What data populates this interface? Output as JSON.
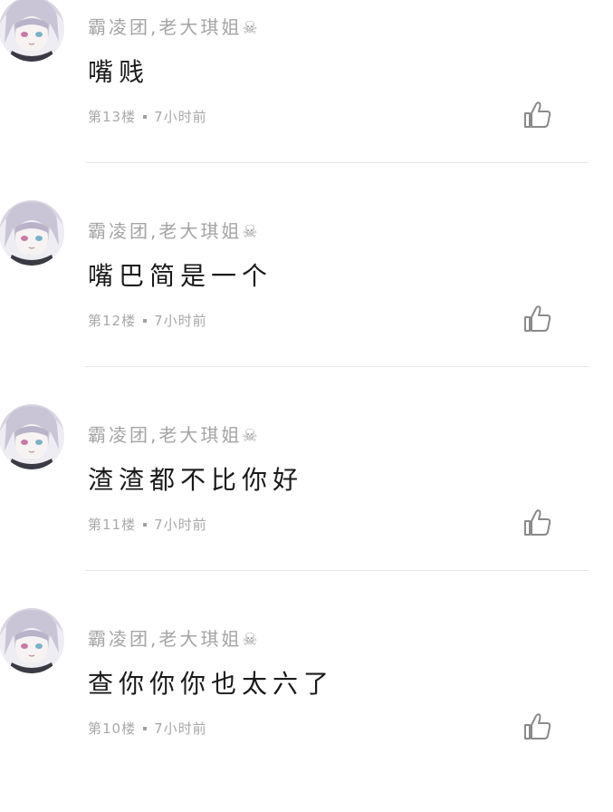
{
  "comments": [
    {
      "username": "霸凌团,老大琪姐",
      "username_icon": "skull-crossbones-icon",
      "text": "嘴贱",
      "floor": "第13楼",
      "time": "7小时前",
      "like_icon": "thumbs-up-icon"
    },
    {
      "username": "霸凌团,老大琪姐",
      "username_icon": "skull-crossbones-icon",
      "text": "嘴巴简是一个",
      "floor": "第12楼",
      "time": "7小时前",
      "like_icon": "thumbs-up-icon"
    },
    {
      "username": "霸凌团,老大琪姐",
      "username_icon": "skull-crossbones-icon",
      "text": "渣渣都不比你好",
      "floor": "第11楼",
      "time": "7小时前",
      "like_icon": "thumbs-up-icon"
    },
    {
      "username": "霸凌团,老大琪姐",
      "username_icon": "skull-crossbones-icon",
      "text": "查你你你也太六了",
      "floor": "第10楼",
      "time": "7小时前",
      "like_icon": "thumbs-up-icon"
    }
  ],
  "colors": {
    "username": "#a4a4a4",
    "content": "#1a1a1a",
    "meta": "#a8a8a8",
    "divider": "#e6e6e6",
    "like_icon": "#8a8a8a"
  }
}
